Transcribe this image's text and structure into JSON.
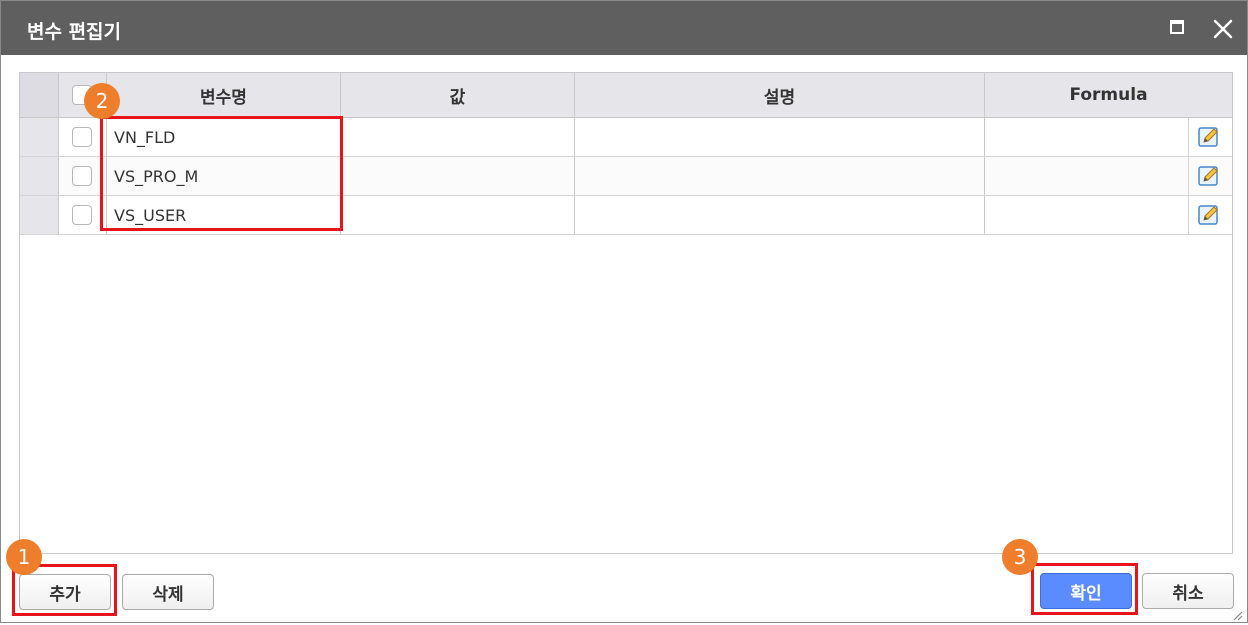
{
  "dialog": {
    "title": "변수 편집기"
  },
  "grid": {
    "columns": [
      "변수명",
      "값",
      "설명",
      "Formula"
    ],
    "rows": [
      {
        "name": "VN_FLD",
        "value": "",
        "description": "",
        "formula": ""
      },
      {
        "name": "VS_PRO_M",
        "value": "",
        "description": "",
        "formula": ""
      },
      {
        "name": "VS_USER",
        "value": "",
        "description": "",
        "formula": ""
      }
    ]
  },
  "buttons": {
    "add": "추가",
    "delete": "삭제",
    "ok": "확인",
    "cancel": "취소"
  },
  "badges": [
    "1",
    "2",
    "3"
  ],
  "icons": {
    "maximize": "maximize-icon",
    "close": "close-icon",
    "edit": "edit-pencil-icon"
  },
  "colors": {
    "titlebar": "#5f5f5f",
    "highlight": "#e8141c",
    "badge": "#ee7d2c",
    "primary_button": "#5a8cff"
  }
}
